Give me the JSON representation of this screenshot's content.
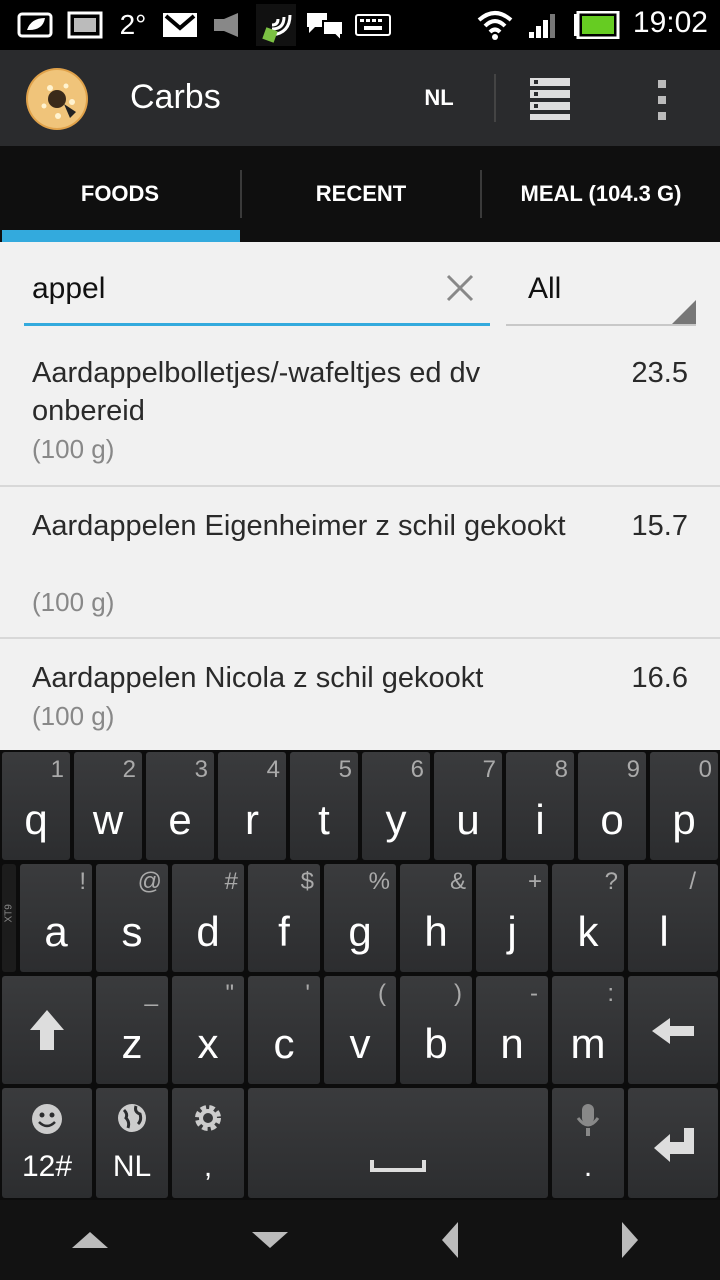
{
  "status_bar": {
    "temperature": "2°",
    "time": "19:02",
    "icons": [
      "leaf-cloud-icon",
      "image-icon",
      "gmail-icon",
      "media-icon",
      "nfc-icon",
      "chat-icon",
      "keyboard-icon",
      "wifi-icon",
      "signal-icon",
      "battery-icon"
    ]
  },
  "action_bar": {
    "title": "Carbs",
    "language_button": "NL",
    "icons": [
      "app-donut-icon",
      "list-view-icon",
      "overflow-menu-icon"
    ]
  },
  "tabs": [
    {
      "label": "FOODS",
      "selected": true
    },
    {
      "label": "RECENT",
      "selected": false
    },
    {
      "label": "MEAL (104.3 G)",
      "selected": false
    }
  ],
  "search": {
    "value": "appel",
    "filter": "All"
  },
  "foods": [
    {
      "name": "Aardappelbolletjes/-wafeltjes ed dv onbereid",
      "value": "23.5",
      "portion": "(100 g)"
    },
    {
      "name": "Aardappelen Eigenheimer z schil gekookt",
      "value": "15.7",
      "portion": "(100 g)"
    },
    {
      "name": "Aardappelen Nicola z schil gekookt",
      "value": "16.6",
      "portion": "(100 g)"
    }
  ],
  "keyboard": {
    "row1": [
      {
        "key": "q",
        "hint": "1"
      },
      {
        "key": "w",
        "hint": "2"
      },
      {
        "key": "e",
        "hint": "3"
      },
      {
        "key": "r",
        "hint": "4"
      },
      {
        "key": "t",
        "hint": "5"
      },
      {
        "key": "y",
        "hint": "6"
      },
      {
        "key": "u",
        "hint": "7"
      },
      {
        "key": "i",
        "hint": "8"
      },
      {
        "key": "o",
        "hint": "9"
      },
      {
        "key": "p",
        "hint": "0"
      }
    ],
    "row2": [
      {
        "key": "a",
        "hint": "!"
      },
      {
        "key": "s",
        "hint": "@"
      },
      {
        "key": "d",
        "hint": "#"
      },
      {
        "key": "f",
        "hint": "$"
      },
      {
        "key": "g",
        "hint": "%"
      },
      {
        "key": "h",
        "hint": "&"
      },
      {
        "key": "j",
        "hint": "+"
      },
      {
        "key": "k",
        "hint": "?"
      },
      {
        "key": "l",
        "hint": "/"
      }
    ],
    "row2_side_label": "XT9",
    "row3": [
      {
        "key": "z",
        "hint": "_"
      },
      {
        "key": "x",
        "hint": "\""
      },
      {
        "key": "c",
        "hint": "'"
      },
      {
        "key": "v",
        "hint": "("
      },
      {
        "key": "b",
        "hint": ")"
      },
      {
        "key": "n",
        "hint": "-"
      },
      {
        "key": "m",
        "hint": ":"
      }
    ],
    "row4": {
      "symbols_label": "12#",
      "language_label": "NL",
      "comma_label": ",",
      "period_label": "."
    }
  }
}
